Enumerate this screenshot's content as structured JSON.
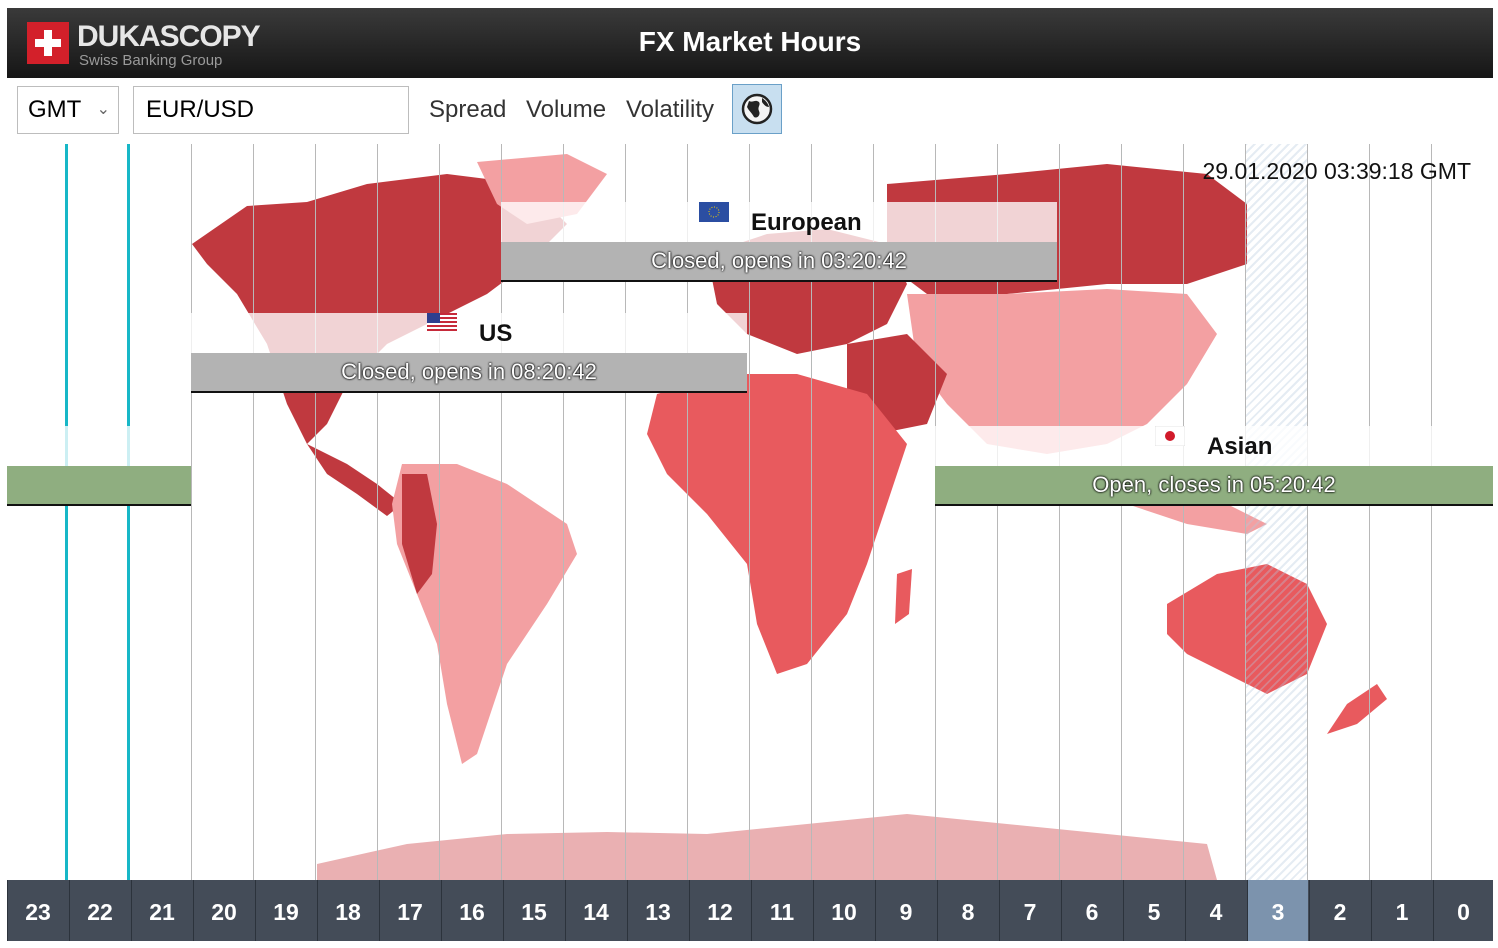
{
  "header": {
    "logo_name": "DUKASCOPY",
    "logo_sub": "Swiss Banking Group",
    "title": "FX Market Hours"
  },
  "toolbar": {
    "timezone": "GMT",
    "pair": "EUR/USD",
    "links": [
      "Spread",
      "Volume",
      "Volatility"
    ],
    "globe_icon": "globe-icon"
  },
  "clock": "29.01.2020 03:39:18 GMT",
  "sessions": {
    "european": {
      "name": "European",
      "status": "Closed, opens in 03:20:42",
      "state": "closed"
    },
    "us": {
      "name": "US",
      "status": "Closed, opens in 08:20:42",
      "state": "closed"
    },
    "asian": {
      "name": "Asian",
      "status": "Open, closes in 05:20:42",
      "state": "open"
    }
  },
  "hours": [
    "23",
    "22",
    "21",
    "20",
    "19",
    "18",
    "17",
    "16",
    "15",
    "14",
    "13",
    "12",
    "11",
    "10",
    "9",
    "8",
    "7",
    "6",
    "5",
    "4",
    "3",
    "2",
    "1",
    "0"
  ],
  "current_hour": "3",
  "colors": {
    "map_dark": "#c0393f",
    "map_mid": "#e85a5e",
    "map_light": "#f3a0a2",
    "session_open": "#8fae80",
    "session_closed": "#b3b3b3",
    "accent_line": "#17b7c7"
  }
}
